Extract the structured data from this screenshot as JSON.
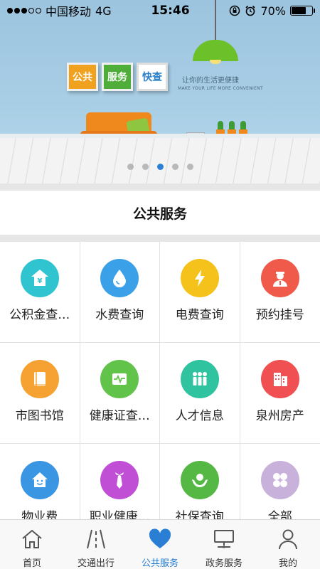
{
  "status_bar": {
    "carrier": "中国移动",
    "network": "4G",
    "time": "15:46",
    "battery_percent": "70%",
    "battery_level": 0.7
  },
  "banner": {
    "tiles": [
      "公共",
      "服务",
      "快查"
    ],
    "slogan": "让你的生活更便捷",
    "slogan_en": "MAKE YOUR LIFE MORE CONVENIENT",
    "slide_count": 5,
    "active_slide": 3
  },
  "section": {
    "title": "公共服务"
  },
  "services": [
    {
      "label": "公积金查…",
      "icon": "housing-fund-icon",
      "color": "#2fc4cf"
    },
    {
      "label": "水费查询",
      "icon": "water-drop-icon",
      "color": "#3aa0e8"
    },
    {
      "label": "电费查询",
      "icon": "lightning-icon",
      "color": "#f5c21b"
    },
    {
      "label": "预约挂号",
      "icon": "doctor-icon",
      "color": "#f05a4a"
    },
    {
      "label": "市图书馆",
      "icon": "book-icon",
      "color": "#f6a233"
    },
    {
      "label": "健康证查…",
      "icon": "health-certificate-icon",
      "color": "#62c34b"
    },
    {
      "label": "人才信息",
      "icon": "people-icon",
      "color": "#2fc3a0"
    },
    {
      "label": "泉州房产",
      "icon": "building-icon",
      "color": "#f05052"
    },
    {
      "label": "物业费",
      "icon": "house-smile-icon",
      "color": "#3a96e3"
    },
    {
      "label": "职业健康…",
      "icon": "tie-icon",
      "color": "#c04fd6"
    },
    {
      "label": "社保查询",
      "icon": "social-security-icon",
      "color": "#55b845"
    },
    {
      "label": "全部",
      "icon": "all-clover-icon",
      "color": "#c8b2dc"
    }
  ],
  "tabbar": {
    "active": 2,
    "items": [
      {
        "label": "首页",
        "icon": "home-icon"
      },
      {
        "label": "交通出行",
        "icon": "road-icon"
      },
      {
        "label": "公共服务",
        "icon": "heart-icon"
      },
      {
        "label": "政务服务",
        "icon": "monitor-icon"
      },
      {
        "label": "我的",
        "icon": "user-icon"
      }
    ]
  }
}
